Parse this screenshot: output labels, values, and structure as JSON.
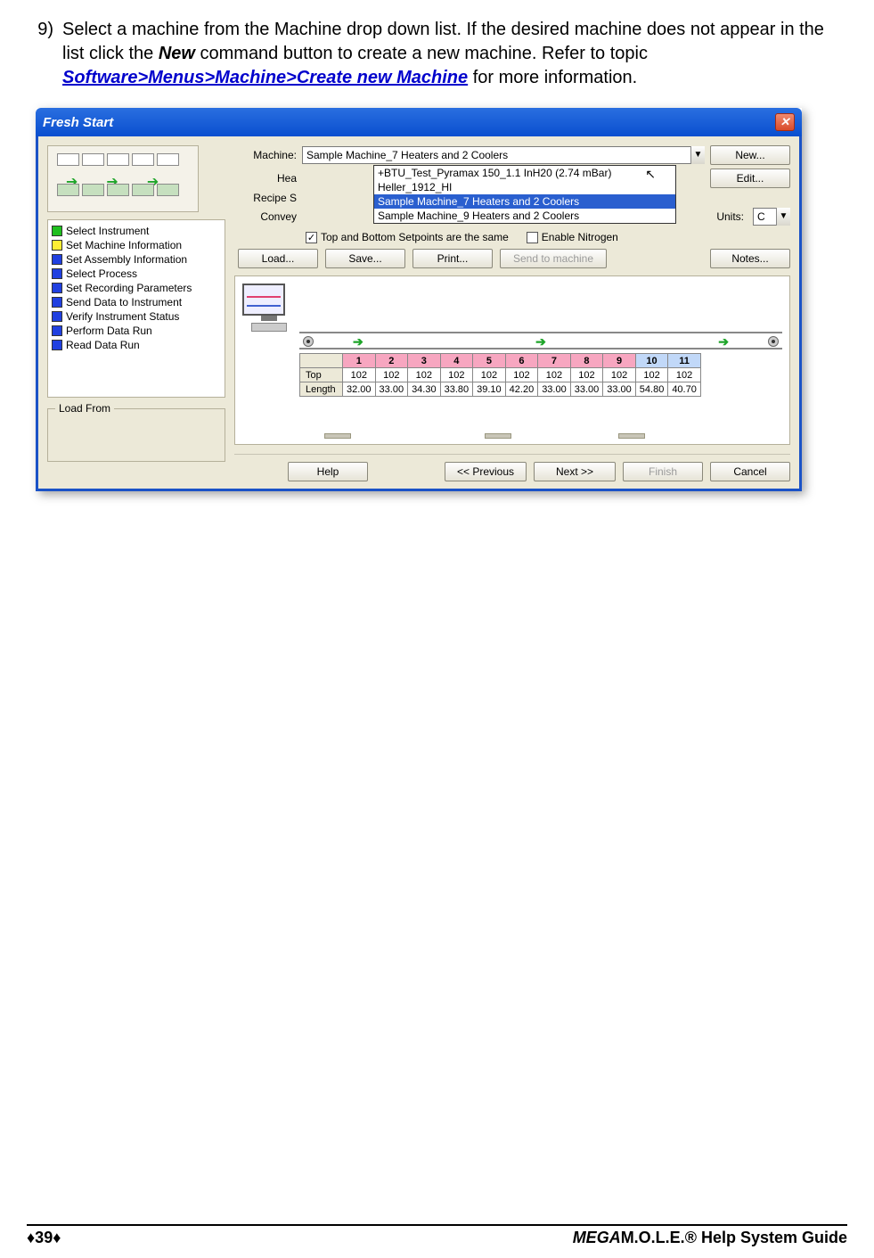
{
  "instruction": {
    "number": "9)",
    "pre": "Select a machine from the Machine drop down list. If the desired machine does not appear in the list click the ",
    "newword": "New",
    "mid": " command button to create a new machine. Refer to topic ",
    "link": "Software>Menus>Machine>Create new Machine",
    "post": " for more information."
  },
  "dialog": {
    "title": "Fresh Start",
    "steps": [
      {
        "color": "g",
        "label": "Select Instrument"
      },
      {
        "color": "y",
        "label": "Set Machine Information"
      },
      {
        "color": "b",
        "label": "Set Assembly Information"
      },
      {
        "color": "b",
        "label": "Select Process"
      },
      {
        "color": "b",
        "label": "Set Recording Parameters"
      },
      {
        "color": "b",
        "label": "Send Data to Instrument"
      },
      {
        "color": "b",
        "label": "Verify Instrument Status"
      },
      {
        "color": "b",
        "label": "Perform Data Run"
      },
      {
        "color": "b",
        "label": "Read Data Run"
      }
    ],
    "load_from_label": "Load From",
    "labels": {
      "machine": "Machine:",
      "hea": "Hea",
      "recipe": "Recipe S",
      "convey": "Convey",
      "units": "Units:"
    },
    "machine_value": "Sample Machine_7 Heaters and 2 Coolers",
    "dropdown": [
      "+BTU_Test_Pyramax 150_1.1 InH20 (2.74 mBar)",
      "Heller_1912_HI",
      "Sample Machine_7 Heaters and 2 Coolers",
      "Sample Machine_9 Heaters and 2 Coolers"
    ],
    "units_value": "C",
    "check1": "Top and Bottom Setpoints are the same",
    "check2": "Enable Nitrogen",
    "buttons": {
      "new": "New...",
      "edit": "Edit...",
      "load": "Load...",
      "save": "Save...",
      "print": "Print...",
      "send": "Send to machine",
      "notes": "Notes...",
      "help": "Help",
      "prev": "<< Previous",
      "next": "Next >>",
      "finish": "Finish",
      "cancel": "Cancel"
    },
    "zone_headers": [
      "1",
      "2",
      "3",
      "4",
      "5",
      "6",
      "7",
      "8",
      "9",
      "10",
      "11"
    ],
    "row_top_label": "Top",
    "row_len_label": "Length",
    "row_top": [
      "102",
      "102",
      "102",
      "102",
      "102",
      "102",
      "102",
      "102",
      "102",
      "102",
      "102"
    ],
    "row_len": [
      "32.00",
      "33.00",
      "34.30",
      "33.80",
      "39.10",
      "42.20",
      "33.00",
      "33.00",
      "33.00",
      "54.80",
      "40.70"
    ]
  },
  "footer": {
    "page": "♦39♦",
    "mega": "MEGA",
    "rest": "M.O.L.E.® Help System Guide"
  }
}
